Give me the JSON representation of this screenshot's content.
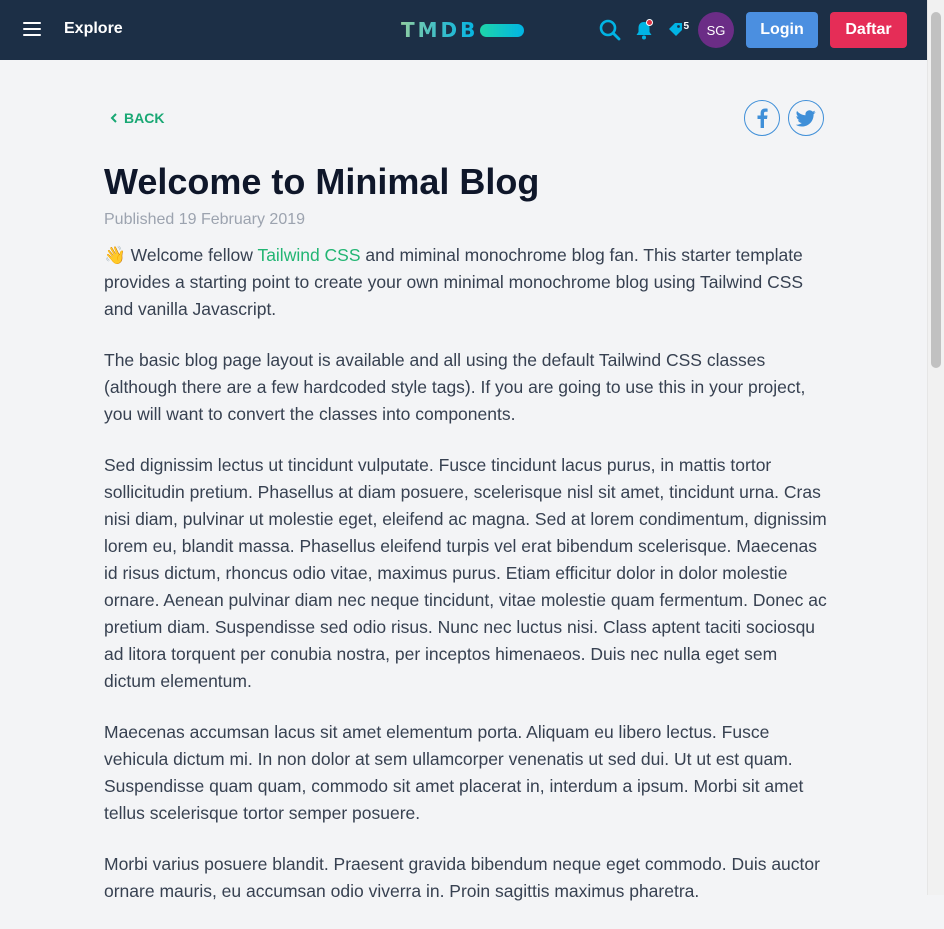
{
  "header": {
    "explore_label": "Explore",
    "brand_text": "TMDB",
    "notification_count": "5",
    "avatar_initials": "SG",
    "login_label": "Login",
    "daftar_label": "Daftar",
    "icons": {
      "menu": "hamburger-menu-icon",
      "search": "search-icon",
      "notifications": "bell-icon",
      "tags": "tag-icon"
    },
    "colors": {
      "background": "#1c2f46",
      "login": "#4b8fe0",
      "daftar": "#e52d57",
      "avatar": "#6b2d86",
      "accent_icons": "#01b4e4"
    }
  },
  "article": {
    "back_label": "BACK",
    "share_icons": [
      "facebook-icon",
      "twitter-icon"
    ],
    "title": "Welcome to Minimal Blog",
    "published": "Published 19 February 2019",
    "intro": {
      "emoji": "👋",
      "before_link": " Welcome fellow ",
      "link_text": "Tailwind CSS",
      "after_link": " and miminal monochrome blog fan. This starter template provides a starting point to create your own minimal monochrome blog using Tailwind CSS and vanilla Javascript."
    },
    "paragraphs": [
      "The basic blog page layout is available and all using the default Tailwind CSS classes (although there are a few hardcoded style tags). If you are going to use this in your project, you will want to convert the classes into components.",
      "Sed dignissim lectus ut tincidunt vulputate. Fusce tincidunt lacus purus, in mattis tortor sollicitudin pretium. Phasellus at diam posuere, scelerisque nisl sit amet, tincidunt urna. Cras nisi diam, pulvinar ut molestie eget, eleifend ac magna. Sed at lorem condimentum, dignissim lorem eu, blandit massa. Phasellus eleifend turpis vel erat bibendum scelerisque. Maecenas id risus dictum, rhoncus odio vitae, maximus purus. Etiam efficitur dolor in dolor molestie ornare. Aenean pulvinar diam nec neque tincidunt, vitae molestie quam fermentum. Donec ac pretium diam. Suspendisse sed odio risus. Nunc nec luctus nisi. Class aptent taciti sociosqu ad litora torquent per conubia nostra, per inceptos himenaeos. Duis nec nulla eget sem dictum elementum.",
      "Maecenas accumsan lacus sit amet elementum porta. Aliquam eu libero lectus. Fusce vehicula dictum mi. In non dolor at sem ullamcorper venenatis ut sed dui. Ut ut est quam. Suspendisse quam quam, commodo sit amet placerat in, interdum a ipsum. Morbi sit amet tellus scelerisque tortor semper posuere.",
      "Morbi varius posuere blandit. Praesent gravida bibendum neque eget commodo. Duis auctor ornare mauris, eu accumsan odio viverra in. Proin sagittis maximus pharetra."
    ],
    "colors": {
      "link": "#22b573",
      "back": "#19a874",
      "share_border": "#3f8fd8"
    }
  }
}
